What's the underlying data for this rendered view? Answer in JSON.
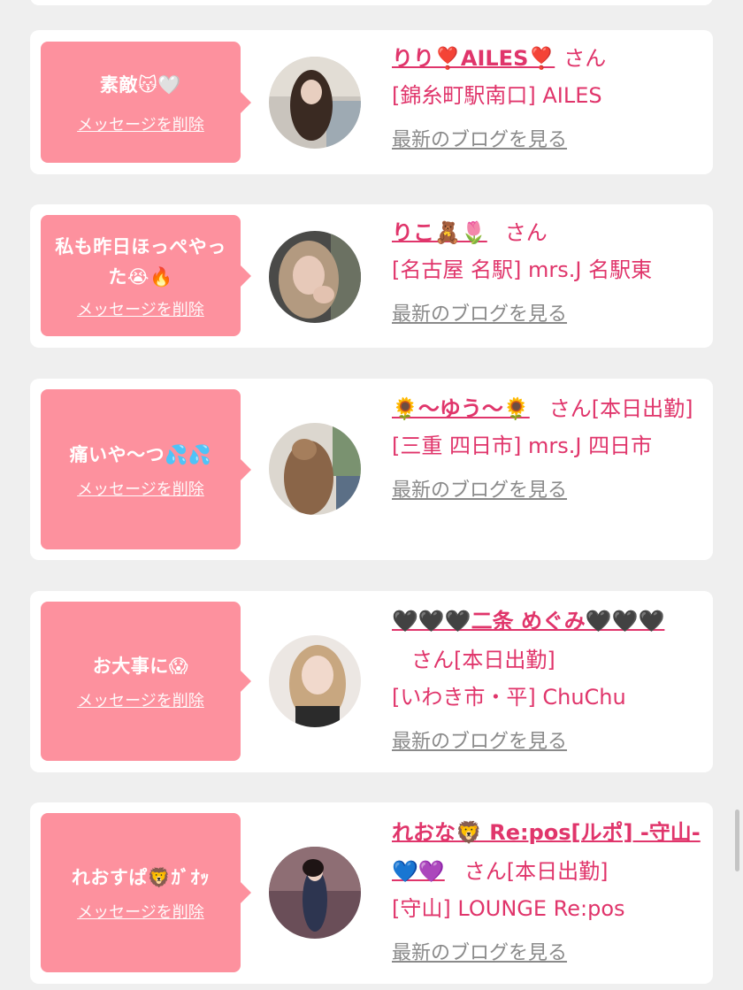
{
  "delete_label": "メッセージを削除",
  "blog_label": "最新のブログを見る",
  "san_label": "さん",
  "colors": {
    "bubble": "#fd919e",
    "accent": "#e0356b",
    "muted_link": "#8a8a8a",
    "background": "#efefef"
  },
  "cards": [
    {
      "message": "素敵😽🤍",
      "name": "りり❣️AILES❣️",
      "san_suffix": "さん",
      "shop": "[錦糸町駅南口] AILES"
    },
    {
      "message": "私も昨日ほっぺやった😭🔥",
      "name": "りこ🧸🌷",
      "san_suffix": "さん",
      "shop": "[名古屋 名駅] mrs.J 名駅東"
    },
    {
      "message": "痛いや〜つ💦💦",
      "name": "🌻〜ゆう〜🌻",
      "san_suffix": "さん[本日出勤]",
      "shop": "[三重 四日市] mrs.J 四日市"
    },
    {
      "message": "お大事に😱",
      "name": "🖤🖤🖤二条 めぐみ🖤🖤🖤",
      "san_suffix": "さん[本日出勤]",
      "shop": "[いわき市・平] ChuChu"
    },
    {
      "message": "れおすぱ🦁ｶﾞｵｯ",
      "name": "れおな🦁 Re:pos[ルポ] -守山-💙💜",
      "san_suffix": "さん[本日出勤]",
      "shop": "[守山] LOUNGE Re:pos"
    }
  ]
}
